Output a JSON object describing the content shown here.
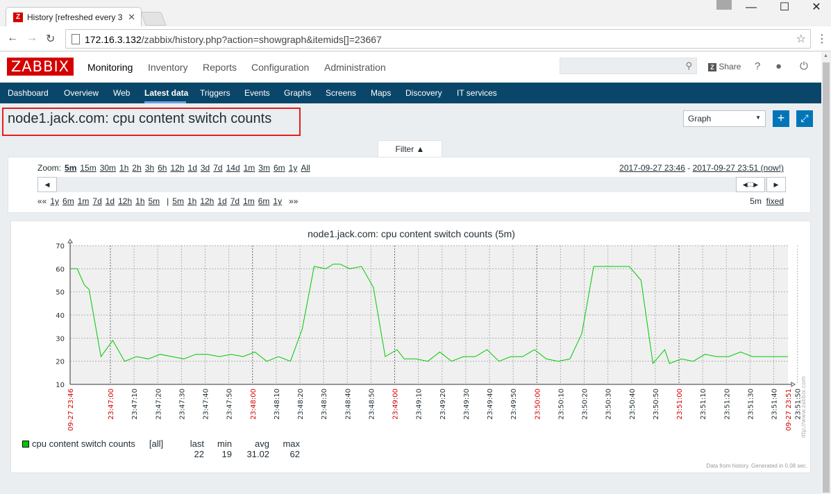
{
  "browser": {
    "tab_title": "History [refreshed every 3",
    "tab_favicon": "Z",
    "url_host": "172.16.3.132",
    "url_path": "/zabbix/history.php?action=showgraph&itemids[]=23667"
  },
  "header": {
    "logo": "ZABBIX",
    "menu": [
      "Monitoring",
      "Inventory",
      "Reports",
      "Configuration",
      "Administration"
    ],
    "share": "Share",
    "help": "?"
  },
  "subnav": [
    "Dashboard",
    "Overview",
    "Web",
    "Latest data",
    "Triggers",
    "Events",
    "Graphs",
    "Screens",
    "Maps",
    "Discovery",
    "IT services"
  ],
  "page": {
    "title": "node1.jack.com: cpu content switch counts",
    "view_select": "Graph",
    "filter_tab": "Filter ▲"
  },
  "filter": {
    "zoom_label": "Zoom:",
    "zoom_options": [
      "5m",
      "15m",
      "30m",
      "1h",
      "2h",
      "3h",
      "6h",
      "12h",
      "1d",
      "3d",
      "7d",
      "14d",
      "1m",
      "3m",
      "6m",
      "1y",
      "All"
    ],
    "date_from": "2017-09-27 23:46",
    "date_sep": " - ",
    "date_to": "2017-09-27 23:51 (now!)",
    "nav_back": "««",
    "nav_back_options": [
      "1y",
      "6m",
      "1m",
      "7d",
      "1d",
      "12h",
      "1h",
      "5m"
    ],
    "nav_sep": "|",
    "nav_fwd_options": [
      "5m",
      "1h",
      "12h",
      "1d",
      "7d",
      "1m",
      "6m",
      "1y"
    ],
    "nav_fwd": "»»",
    "period": "5m",
    "fixed": "fixed"
  },
  "chart_data": {
    "type": "line",
    "title": "node1.jack.com: cpu content switch counts (5m)",
    "ylim": [
      10,
      70
    ],
    "yticks": [
      10,
      20,
      30,
      40,
      50,
      60,
      70
    ],
    "x_start_label": "09-27 23:46",
    "x_end_label": "09-27 23:51",
    "x_labels": [
      "23:47:00",
      "23:47:10",
      "23:47:20",
      "23:47:30",
      "23:47:40",
      "23:47:50",
      "23:48:00",
      "23:48:10",
      "23:48:20",
      "23:48:30",
      "23:48:40",
      "23:48:50",
      "23:49:00",
      "23:49:10",
      "23:49:20",
      "23:49:30",
      "23:49:40",
      "23:49:50",
      "23:50:00",
      "23:50:10",
      "23:50:20",
      "23:50:30",
      "23:50:40",
      "23:50:50",
      "23:51:00",
      "23:51:10",
      "23:51:20",
      "23:51:30",
      "23:51:40",
      "23:51:50"
    ],
    "x_major_labels": [
      "23:47:00",
      "23:48:00",
      "23:49:00",
      "23:50:00",
      "23:51:00"
    ],
    "series": [
      {
        "name": "cpu content switch counts",
        "color": "#00c800",
        "x_seconds": [
          0,
          3,
          6,
          8,
          13,
          18,
          23,
          28,
          33,
          38,
          43,
          48,
          53,
          58,
          63,
          68,
          73,
          78,
          83,
          88,
          93,
          98,
          103,
          108,
          111,
          114,
          118,
          123,
          128,
          133,
          138,
          141,
          146,
          151,
          156,
          161,
          166,
          171,
          176,
          181,
          186,
          191,
          196,
          201,
          206,
          211,
          216,
          221,
          224,
          226,
          231,
          236,
          241,
          246,
          251,
          253,
          258,
          263,
          268,
          273,
          278,
          283,
          288,
          293,
          298,
          303
        ],
        "values": [
          60,
          60,
          53,
          51,
          22,
          29,
          20,
          22,
          21,
          23,
          22,
          21,
          23,
          23,
          22,
          23,
          22,
          24,
          20,
          22,
          20,
          34,
          61,
          60,
          62,
          62,
          60,
          61,
          52,
          22,
          25,
          21,
          21,
          20,
          24,
          20,
          22,
          22,
          25,
          20,
          22,
          22,
          25,
          21,
          20,
          21,
          32,
          61,
          61,
          61,
          61,
          61,
          55,
          19,
          25,
          19,
          21,
          20,
          23,
          22,
          22,
          24,
          22,
          22,
          22,
          22
        ]
      }
    ],
    "legend": {
      "item": "cpu content switch counts",
      "scope": "[all]",
      "headers": [
        "last",
        "min",
        "avg",
        "max"
      ],
      "values": [
        "22",
        "19",
        "31.02",
        "62"
      ]
    },
    "watermark": "http://www.zabbix.com",
    "footer": "Data from history. Generated in 0.08 sec."
  }
}
